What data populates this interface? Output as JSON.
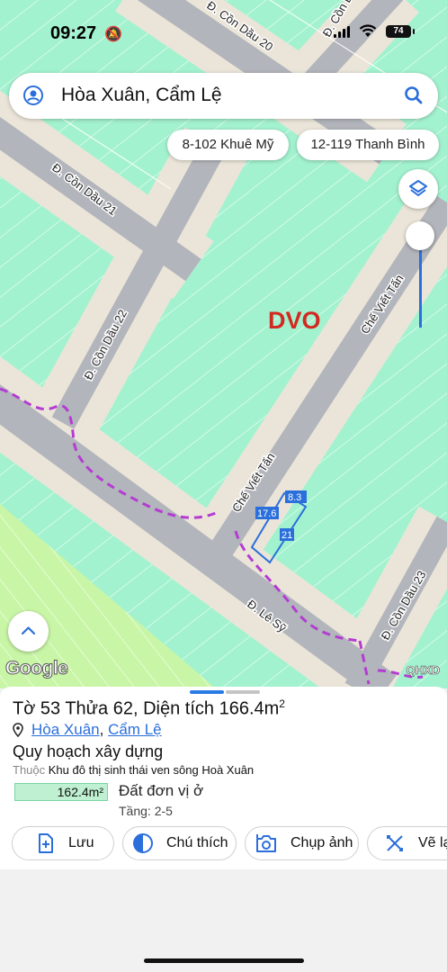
{
  "status_bar": {
    "time": "09:27",
    "battery": "74"
  },
  "search": {
    "text": "Hòa Xuân, Cẩm Lệ"
  },
  "chips": [
    {
      "label": "8-102 Khuê Mỹ"
    },
    {
      "label": "12-119 Thanh Bình"
    }
  ],
  "map": {
    "streets": [
      {
        "label": "Đ. Cồn Dầu 20"
      },
      {
        "label": "Đ. Cồn Dầu"
      },
      {
        "label": "Đ. Cồn Dầu 21"
      },
      {
        "label": "Đ. Cồn Dầu 22"
      },
      {
        "label": "Chế Viết Tấn"
      },
      {
        "label": "Chế Viết Tấn"
      },
      {
        "label": "Đ. Cồn Dầu 23"
      },
      {
        "label": "Đ. Lê Sỹ"
      }
    ],
    "watermark": "DVO",
    "dimensions": [
      "8.3",
      "17.6",
      "21"
    ],
    "google_logo": "Google",
    "attribution": "QHXD",
    "colors": {
      "land": "#a3f2cf",
      "road": "#b2b5bb",
      "sidewalk": "#ebe5d9",
      "route": "#b43cd2",
      "watermark": "#d12a22"
    }
  },
  "sheet": {
    "title_main": "Tờ 53 Thửa 62, Diện tích 166.4m",
    "title_sup": "2",
    "ward": "Hòa Xuân",
    "district": "Cẩm Lệ",
    "plan_title": "Quy hoạch xây dựng",
    "belongs_label": "Thuộc",
    "belongs_value": "Khu đô thị sinh thái ven sông Hoà Xuân",
    "area": "162.4m²",
    "land_type": "Đất đơn vị ở",
    "floors": "Tầng: 2-5",
    "actions": [
      {
        "label": "Lưu",
        "icon": "add-file-icon"
      },
      {
        "label": "Chú thích",
        "icon": "contrast-icon"
      },
      {
        "label": "Chụp ảnh",
        "icon": "add-photo-icon"
      },
      {
        "label": "Vẽ lạ",
        "icon": "measure-icon"
      }
    ],
    "accent": "#2a6fdb"
  }
}
